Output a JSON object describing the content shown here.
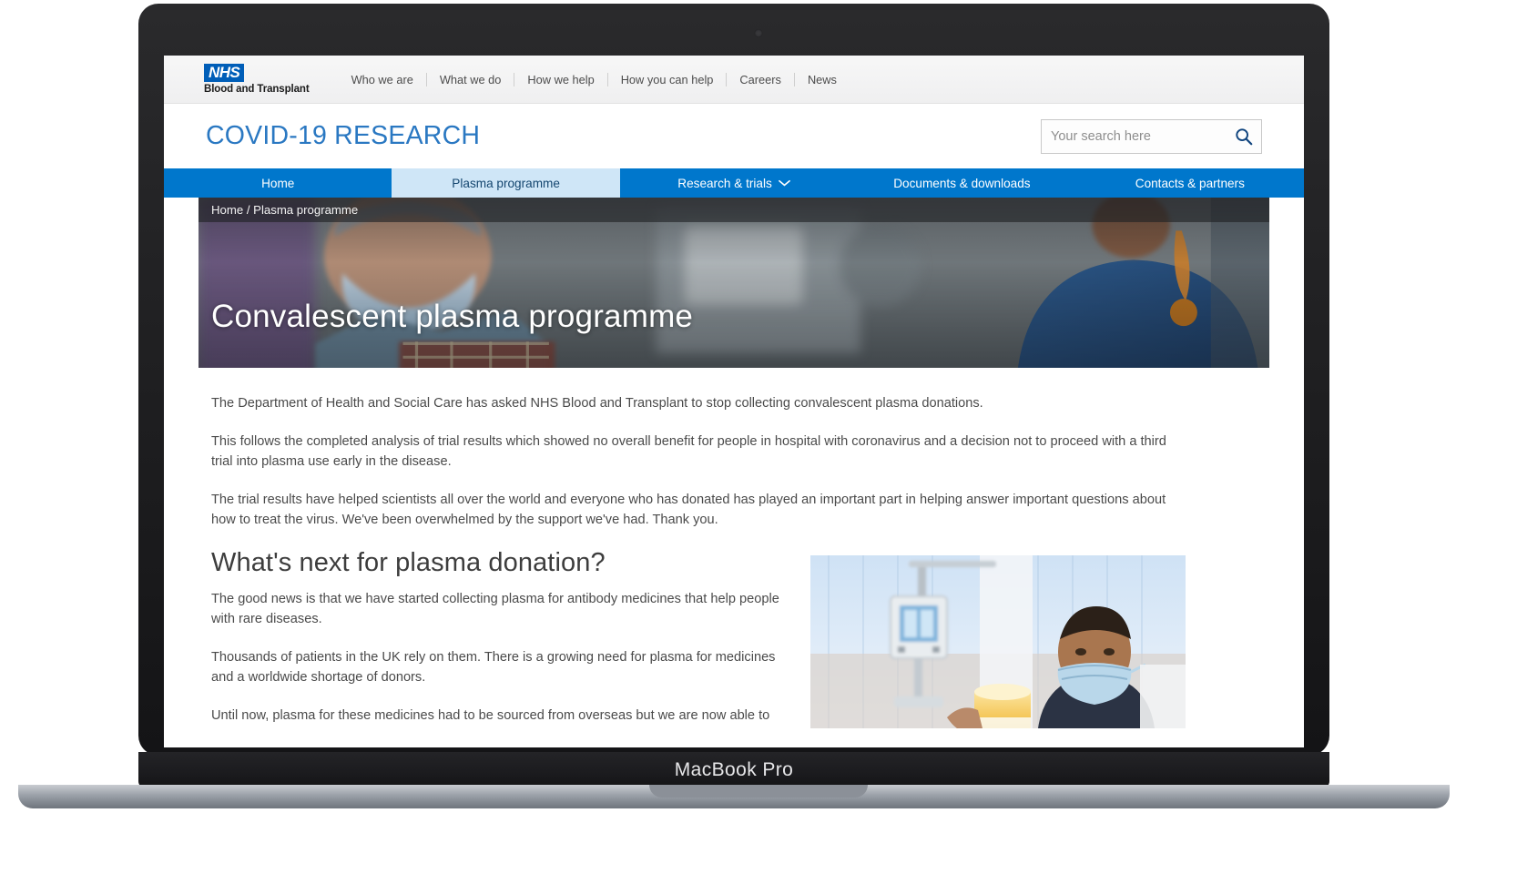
{
  "device": {
    "label": "MacBook Pro"
  },
  "header": {
    "logo": {
      "badge": "NHS",
      "subtitle": "Blood and Transplant"
    },
    "utility_links": [
      "Who we are",
      "What we do",
      "How we help",
      "How you can help",
      "Careers",
      "News"
    ],
    "site_title": "COVID-19 RESEARCH",
    "search": {
      "placeholder": "Your search here",
      "value": "",
      "icon": "search-icon"
    },
    "accent_color": "#0077cc",
    "nhs_blue": "#005eb8"
  },
  "nav": {
    "items": [
      {
        "label": "Home",
        "active": false,
        "has_dropdown": false
      },
      {
        "label": "Plasma programme",
        "active": true,
        "has_dropdown": false
      },
      {
        "label": "Research & trials",
        "active": false,
        "has_dropdown": true
      },
      {
        "label": "Documents & downloads",
        "active": false,
        "has_dropdown": false
      },
      {
        "label": "Contacts & partners",
        "active": false,
        "has_dropdown": false
      }
    ]
  },
  "hero": {
    "breadcrumb": "Home / Plasma programme",
    "title": "Convalescent plasma programme"
  },
  "main": {
    "intro_paragraphs": [
      "The Department of Health and Social Care has asked NHS Blood and Transplant to stop collecting convalescent plasma donations.",
      "This follows the completed analysis of trial results which showed no overall benefit for people in hospital with coronavirus and a decision not to proceed with a third trial into plasma use early in the disease.",
      "The trial results have helped scientists all over the world and everyone who has donated has played an important part in helping answer important questions about how to treat the virus. We've been overwhelmed by the support we've had. Thank you."
    ],
    "section": {
      "heading": "What's next for plasma donation?",
      "paragraphs": [
        "The good news is that we have started collecting plasma for antibody medicines that help people with rare diseases.",
        "Thousands of patients in the UK rely on them. There is a growing need for plasma for medicines and a worldwide shortage of donors.",
        "Until now, plasma for these medicines had to be sourced from overseas but we are now able to"
      ]
    },
    "photo_alt": "plasma-donor-photo"
  }
}
